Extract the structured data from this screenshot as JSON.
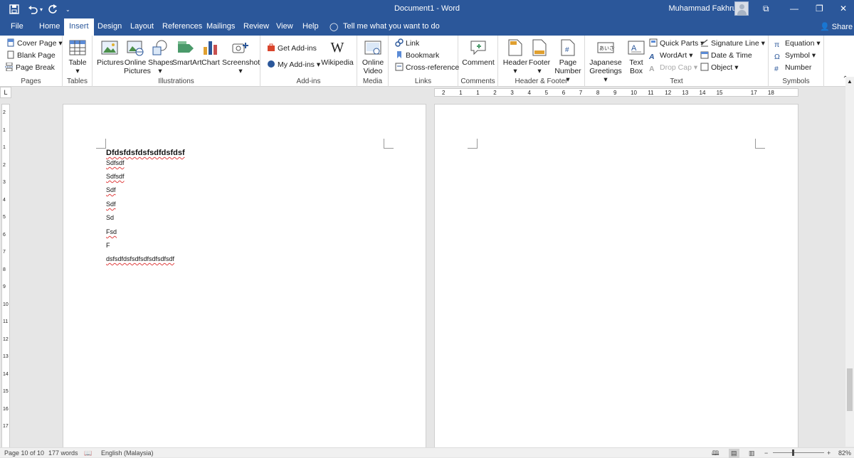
{
  "app": {
    "doc_title": "Document1 - Word",
    "user": "Muhammad Fakhrullah",
    "share": "Share"
  },
  "tabs": [
    {
      "label": "File"
    },
    {
      "label": "Home"
    },
    {
      "label": "Insert"
    },
    {
      "label": "Design"
    },
    {
      "label": "Layout"
    },
    {
      "label": "References"
    },
    {
      "label": "Mailings"
    },
    {
      "label": "Review"
    },
    {
      "label": "View"
    },
    {
      "label": "Help"
    }
  ],
  "tell_me": "Tell me what you want to do",
  "ribbon": {
    "pages": {
      "label": "Pages",
      "cover": "Cover Page",
      "blank": "Blank Page",
      "break": "Page Break"
    },
    "tables": {
      "label": "Tables",
      "table": "Table"
    },
    "illustrations": {
      "label": "Illustrations",
      "pictures": "Pictures",
      "online_pictures": "Online Pictures",
      "shapes": "Shapes",
      "smartart": "SmartArt",
      "chart": "Chart",
      "screenshot": "Screenshot"
    },
    "addins": {
      "label": "Add-ins",
      "get": "Get Add-ins",
      "my": "My Add-ins",
      "wiki": "Wikipedia"
    },
    "media": {
      "label": "Media",
      "video": "Online Video"
    },
    "links": {
      "label": "Links",
      "link": "Link",
      "bookmark": "Bookmark",
      "xref": "Cross-reference"
    },
    "comments": {
      "label": "Comments",
      "comment": "Comment"
    },
    "hf": {
      "label": "Header & Footer",
      "header": "Header",
      "footer": "Footer",
      "page_number": "Page Number"
    },
    "text": {
      "label": "Text",
      "jp": "Japanese Greetings",
      "textbox": "Text Box",
      "quick": "Quick Parts",
      "wordart": "WordArt",
      "dropcap": "Drop Cap",
      "sig": "Signature Line",
      "date": "Date & Time",
      "object": "Object"
    },
    "symbols": {
      "label": "Symbols",
      "equation": "Equation",
      "symbol": "Symbol",
      "number": "Number"
    }
  },
  "ruler_h": [
    "2",
    "1",
    "1",
    "2",
    "3",
    "4",
    "5",
    "6",
    "7",
    "8",
    "9",
    "10",
    "11",
    "12",
    "13",
    "14",
    "15",
    "",
    "17",
    "18"
  ],
  "ruler_v": [
    "2",
    "1",
    "1",
    "2",
    "3",
    "4",
    "5",
    "6",
    "7",
    "8",
    "9",
    "10",
    "11",
    "12",
    "13",
    "14",
    "15",
    "16",
    "17"
  ],
  "document": {
    "heading": "Dfdsfdsfdsfsdfdsfdsf",
    "lines": [
      "Sdfsdf",
      "Sdfsdf",
      "Sdf",
      "Sdf",
      "Sd",
      "Fsd",
      "F",
      "dsfsdfdsfsdfsdfsdfsdfsdf"
    ]
  },
  "status": {
    "page": "Page 10 of 10",
    "words": "177 words",
    "language": "English (Malaysia)",
    "zoom": "82%"
  },
  "colors": {
    "accent": "#2b579a"
  }
}
